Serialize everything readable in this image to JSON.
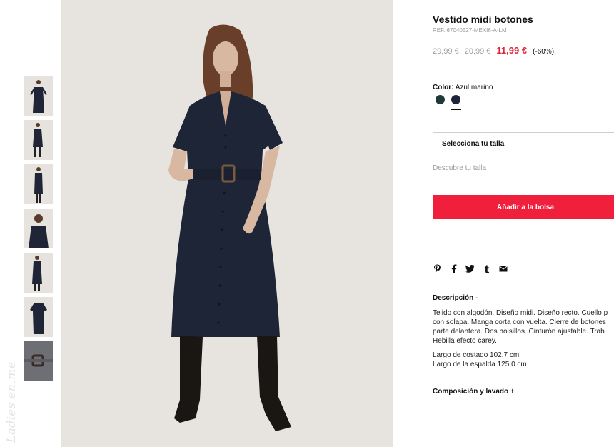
{
  "watermark": "Ladies en.me",
  "product": {
    "title": "Vestido midi botones",
    "ref": "REF. 67040527-MEXI6-A-LM",
    "original_price": "29,99 €",
    "previous_price": "20,99 €",
    "current_price": "11,99 €",
    "discount": "(-60%)"
  },
  "color": {
    "label": "Color:",
    "selected": "Azul marino",
    "swatches": [
      {
        "name": "green",
        "hex": "#1f3a36"
      },
      {
        "name": "navy",
        "hex": "#1e2538"
      }
    ]
  },
  "size": {
    "select_label": "Selecciona tu talla",
    "guide_link": "Descubre tu talla"
  },
  "actions": {
    "add_to_bag": "Añadir a la bolsa"
  },
  "share": {
    "icons": [
      "pinterest-icon",
      "facebook-icon",
      "twitter-icon",
      "tumblr-icon",
      "email-icon"
    ]
  },
  "description": {
    "title": "Descripción -",
    "lines": [
      "Tejido con algodón. Diseño midi. Diseño recto. Cuello p",
      "con solapa. Manga corta con vuelta. Cierre de botones",
      "parte delantera. Dos bolsillos. Cinturón ajustable. Trab",
      "Hebilla efecto carey."
    ],
    "measure_1": "Largo de costado 102.7 cm",
    "measure_2": "Largo de la espalda 125.0 cm"
  },
  "composition": {
    "title": "Composición y lavado +"
  },
  "colors": {
    "accent": "#f01f3c",
    "price_red": "#e0263a",
    "image_bg": "#e7e3de"
  }
}
